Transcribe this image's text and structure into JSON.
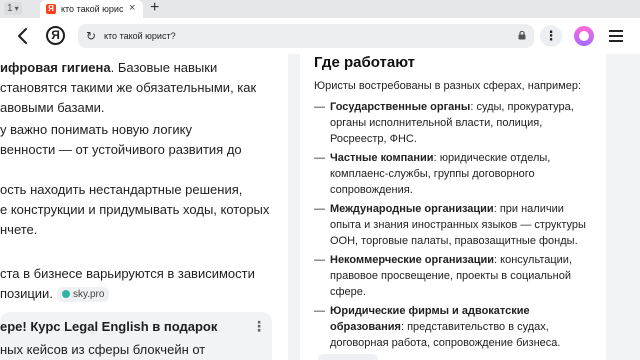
{
  "tabs": {
    "count": "1",
    "active_title": "кто такой юрист?",
    "close_glyph": "×",
    "new_tab_glyph": "+"
  },
  "toolbar": {
    "logo": "Я",
    "url_text": "кто такой юрист?",
    "reload_glyph": "↻",
    "menu_glyph": "⋮"
  },
  "left": {
    "p1": [
      "ифровая гигиена",
      ". Базовые навыки",
      "становятся такими же обязательными, как",
      "авовыми базами."
    ],
    "p2": [
      "у важно понимать новую логику",
      "венности — от устойчивого развития до"
    ],
    "p3": [
      "ость находить нестандартные решения,",
      "е конструкции и придумывать ходы, которых",
      "нчете."
    ],
    "p4": [
      "ста в бизнесе варьируются в зависимости",
      "позиции."
    ],
    "source": "sky.pro",
    "card": {
      "title": "ере! Курс Legal English в подарок",
      "text": "ных кейсов из сферы блокчейн от",
      "more": "⋮"
    }
  },
  "right": {
    "title": "Где работают",
    "intro": "Юристы востребованы в разных сферах, например:",
    "dash": "—",
    "items": [
      {
        "bold": "Государственные органы",
        "lines": [
          ": суды, прокуратура,",
          "органы исполнительной власти, полиция,",
          "Росреестр, ФНС."
        ]
      },
      {
        "bold": "Частные компании",
        "lines": [
          ": юридические отделы,",
          "комплаенс-службы, группы договорного",
          "сопровождения."
        ]
      },
      {
        "bold": "Международные организации",
        "lines": [
          ": при наличии",
          "опыта и знания иностранных языков — структуры",
          "ООН, торговые палаты, правозащитные фонды."
        ]
      },
      {
        "bold": "Некоммерческие организации",
        "lines": [
          ": консультации,",
          "правовое просвещение, проекты в социальной",
          "сфере."
        ]
      },
      {
        "bold": "Юридические фирмы и адвокатские",
        "bold2": "образования",
        "lines": [
          ": представительство в судах,",
          "договорная работа, сопровождение бизнеса."
        ]
      }
    ]
  }
}
